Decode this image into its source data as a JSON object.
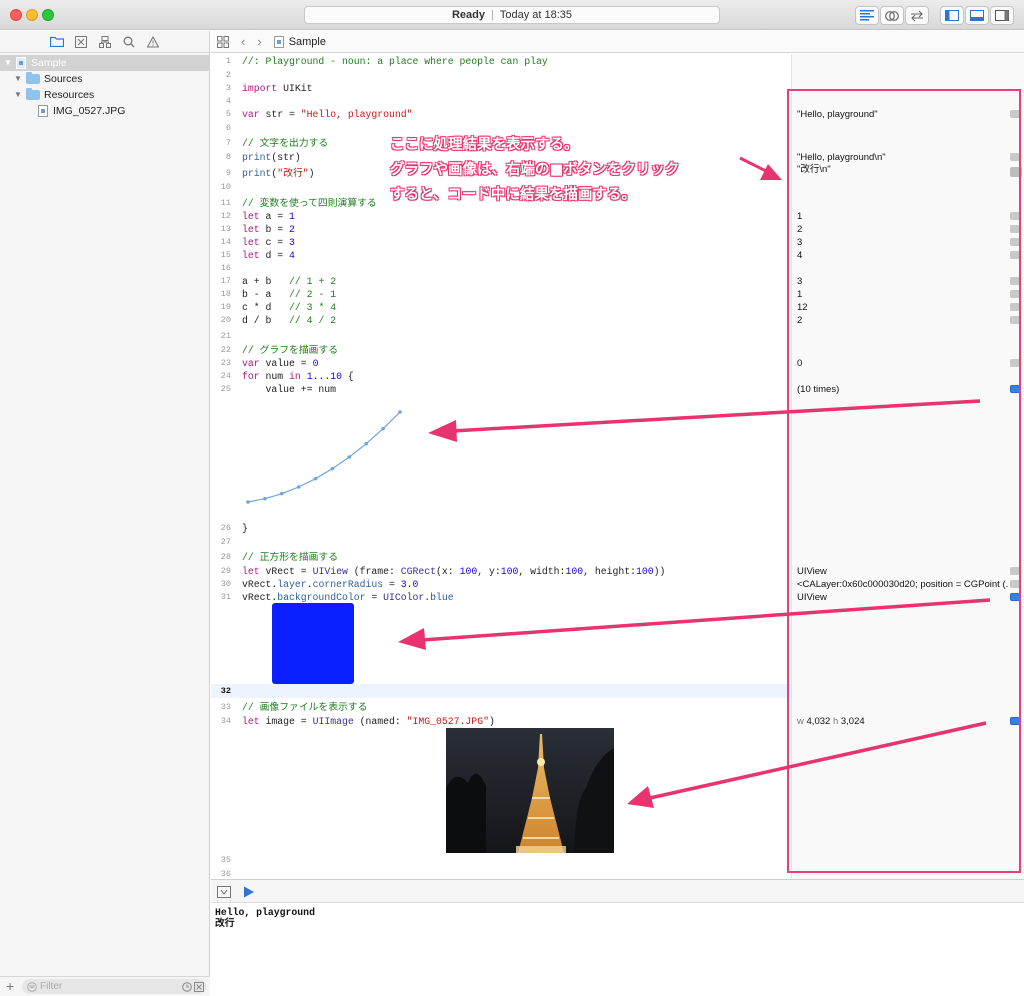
{
  "window": {
    "status": "Ready",
    "timestamp": "Today at 18:35"
  },
  "navigator": {
    "tree": [
      {
        "label": "Sample",
        "kind": "playground",
        "selected": true
      },
      {
        "label": "Sources",
        "kind": "folder"
      },
      {
        "label": "Resources",
        "kind": "folder"
      },
      {
        "label": "IMG_0527.JPG",
        "kind": "file"
      }
    ],
    "filter_placeholder": "Filter"
  },
  "jumpbar": {
    "file": "Sample"
  },
  "code": {
    "lines": [
      {
        "n": "1",
        "y": 0
      },
      {
        "n": "2",
        "y": 0
      },
      {
        "n": "3",
        "y": 0
      },
      {
        "n": "4",
        "y": 0
      },
      {
        "n": "5",
        "y": 0
      },
      {
        "n": "6",
        "y": 0
      },
      {
        "n": "7",
        "y": 0
      },
      {
        "n": "8",
        "y": 0
      },
      {
        "n": "9",
        "y": 0
      },
      {
        "n": "10",
        "y": 0
      },
      {
        "n": "11",
        "y": 0
      },
      {
        "n": "12",
        "y": 0
      },
      {
        "n": "13",
        "y": 0
      },
      {
        "n": "14",
        "y": 0
      },
      {
        "n": "15",
        "y": 0
      },
      {
        "n": "16",
        "y": 0
      },
      {
        "n": "17",
        "y": 0
      },
      {
        "n": "18",
        "y": 0
      },
      {
        "n": "19",
        "y": 0
      },
      {
        "n": "20",
        "y": 0
      },
      {
        "n": "21",
        "y": 0
      },
      {
        "n": "22",
        "y": 0
      },
      {
        "n": "23",
        "y": 0
      },
      {
        "n": "24",
        "y": 0
      },
      {
        "n": "25",
        "y": 0
      },
      {
        "n": "26",
        "y": 0
      },
      {
        "n": "27",
        "y": 0
      },
      {
        "n": "28",
        "y": 0
      },
      {
        "n": "29",
        "y": 0
      },
      {
        "n": "30",
        "y": 0
      },
      {
        "n": "31",
        "y": 0
      },
      {
        "n": "32",
        "y": 0
      },
      {
        "n": "33",
        "y": 0
      },
      {
        "n": "34",
        "y": 0
      },
      {
        "n": "35",
        "y": 0
      },
      {
        "n": "36",
        "y": 0
      }
    ],
    "text": {
      "l1": "//: Playground - noun: a place where people can play",
      "l3_kw": "import",
      "l3_rest": " UIKit",
      "l5_kw": "var",
      "l5_mid": " str = ",
      "l5_str": "\"Hello, playground\"",
      "l7": "// 文字を出力する",
      "l8_fn": "print",
      "l8_rest": "(str)",
      "l9_fn": "print",
      "l9_open": "(",
      "l9_str": "\"改行\"",
      "l9_close": ")",
      "l11": "// 変数を使って四則演算する",
      "l12_kw": "let",
      "l12_mid": " a = ",
      "l12_num": "1",
      "l13_kw": "let",
      "l13_mid": " b = ",
      "l13_num": "2",
      "l14_kw": "let",
      "l14_mid": " c = ",
      "l14_num": "3",
      "l15_kw": "let",
      "l15_mid": " d = ",
      "l15_num": "4",
      "l17_code": "a + b   ",
      "l17_cm": "// 1 + 2",
      "l18_code": "b - a   ",
      "l18_cm": "// 2 - 1",
      "l19_code": "c * d   ",
      "l19_cm": "// 3 * 4",
      "l20_code": "d / b   ",
      "l20_cm": "// 4 / 2",
      "l22": "// グラフを描画する",
      "l23_kw": "var",
      "l23_mid": " value = ",
      "l23_num": "0",
      "l24_kw": "for",
      "l24_a": " num ",
      "l24_in": "in",
      "l24_b": " ",
      "l24_n1": "1",
      "l24_dots": "...",
      "l24_n2": "10",
      "l24_c": " {",
      "l25": "    value += num",
      "l26": "}",
      "l28": "// 正方形を描画する",
      "l29_kw": "let",
      "l29_a": " vRect = ",
      "l29_ty": "UIView",
      "l29_b": " (frame: ",
      "l29_ty2": "CGRect",
      "l29_c": "(x: ",
      "l29_n1": "100",
      "l29_d": ", y:",
      "l29_n2": "100",
      "l29_e": ", width:",
      "l29_n3": "100",
      "l29_f": ", height:",
      "l29_n4": "100",
      "l29_g": "))",
      "l30_a": "vRect.",
      "l30_p1": "layer",
      "l30_b": ".",
      "l30_p2": "cornerRadius",
      "l30_c": " = ",
      "l30_num": "3.0",
      "l31_a": "vRect.",
      "l31_p": "backgroundColor",
      "l31_b": " = ",
      "l31_ty": "UIColor",
      "l31_c": ".",
      "l31_p2": "blue",
      "l33": "// 画像ファイルを表示する",
      "l34_kw": "let",
      "l34_a": " image = ",
      "l34_ty": "UIImage",
      "l34_b": " (named: ",
      "l34_str": "\"IMG_0527.JPG\"",
      "l34_c": ")"
    }
  },
  "results": {
    "r5": "\"Hello, playground\"",
    "r8": "\"Hello, playground\\n\"",
    "r9": "\"改行\\n\"",
    "r12": "1",
    "r13": "2",
    "r14": "3",
    "r15": "4",
    "r17": "3",
    "r18": "1",
    "r19": "12",
    "r20": "2",
    "r23": "0",
    "r25": "(10 times)",
    "r29": "UIView",
    "r30": "<CALayer:0x60c000030d20; position = CGPoint (...",
    "r31": "UIView",
    "r34_w": "w",
    "r34_wv": "4,032",
    "r34_h": "h",
    "r34_hv": "3,024"
  },
  "annotation": {
    "line1": "ここに処理結果を表示する。",
    "line2": "グラフや画像は、右端の■ボタンをクリック",
    "line3": "すると、コード中に結果を描画する。"
  },
  "graph_values": [
    1,
    3,
    6,
    10,
    15,
    21,
    28,
    36,
    45,
    55
  ],
  "console": {
    "line1": "Hello, playground",
    "line2": "改行"
  },
  "colors": {
    "accent": "#e6407a",
    "rect_fill": "#0a1fff",
    "graph_line": "#6ea5d8"
  }
}
